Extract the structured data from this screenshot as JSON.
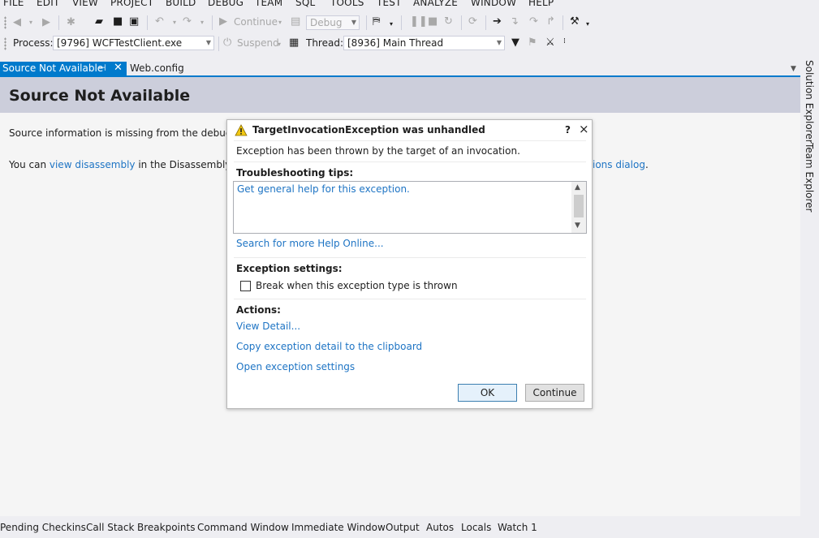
{
  "menu": [
    "FILE",
    "EDIT",
    "VIEW",
    "PROJECT",
    "BUILD",
    "DEBUG",
    "TEAM",
    "SQL",
    "TOOLS",
    "TEST",
    "ANALYZE",
    "WINDOW",
    "HELP"
  ],
  "toolbar": {
    "continue_label": "Continue",
    "config_value": "Debug",
    "process_label": "Process:",
    "process_value": "[9796] WCFTestClient.exe",
    "suspend_label": "Suspend",
    "thread_label": "Thread:",
    "thread_value": "[8936] Main Thread"
  },
  "tabs": {
    "active": "Source Not Available",
    "second": "Web.config"
  },
  "document": {
    "title": "Source Not Available",
    "line1": "Source information is missing from the debug info",
    "line2_prefix": "You can ",
    "line2_link": "view disassembly",
    "line2_mid": " in the Disassembly wind",
    "line2_tail_link": "ions dialog",
    "line2_end": "."
  },
  "sidebar": [
    "Solution Explorer",
    "Team Explorer"
  ],
  "bottom_tabs": [
    "Pending Checkins",
    "Call Stack",
    "Breakpoints",
    "Command Window",
    "Immediate Window",
    "Output",
    "Autos",
    "Locals",
    "Watch 1"
  ],
  "dialog": {
    "title": "TargetInvocationException was unhandled",
    "help_glyph": "?",
    "close_glyph": "×",
    "message": "Exception has been thrown by the target of an invocation.",
    "tips_heading": "Troubleshooting tips:",
    "tip_link": "Get general help for this exception.",
    "search_link": "Search for more Help Online...",
    "settings_heading": "Exception settings:",
    "checkbox_label": "Break when this exception type is thrown",
    "checkbox_checked": false,
    "actions_heading": "Actions:",
    "action_1": "View Detail...",
    "action_2": "Copy exception detail to the clipboard",
    "action_3": "Open exception settings",
    "ok_label": "OK",
    "continue_label": "Continue"
  },
  "colors": {
    "accent": "#007ACC",
    "link": "#1E74C4",
    "header_band": "#CCCEDB",
    "warning": "#F2C811"
  }
}
